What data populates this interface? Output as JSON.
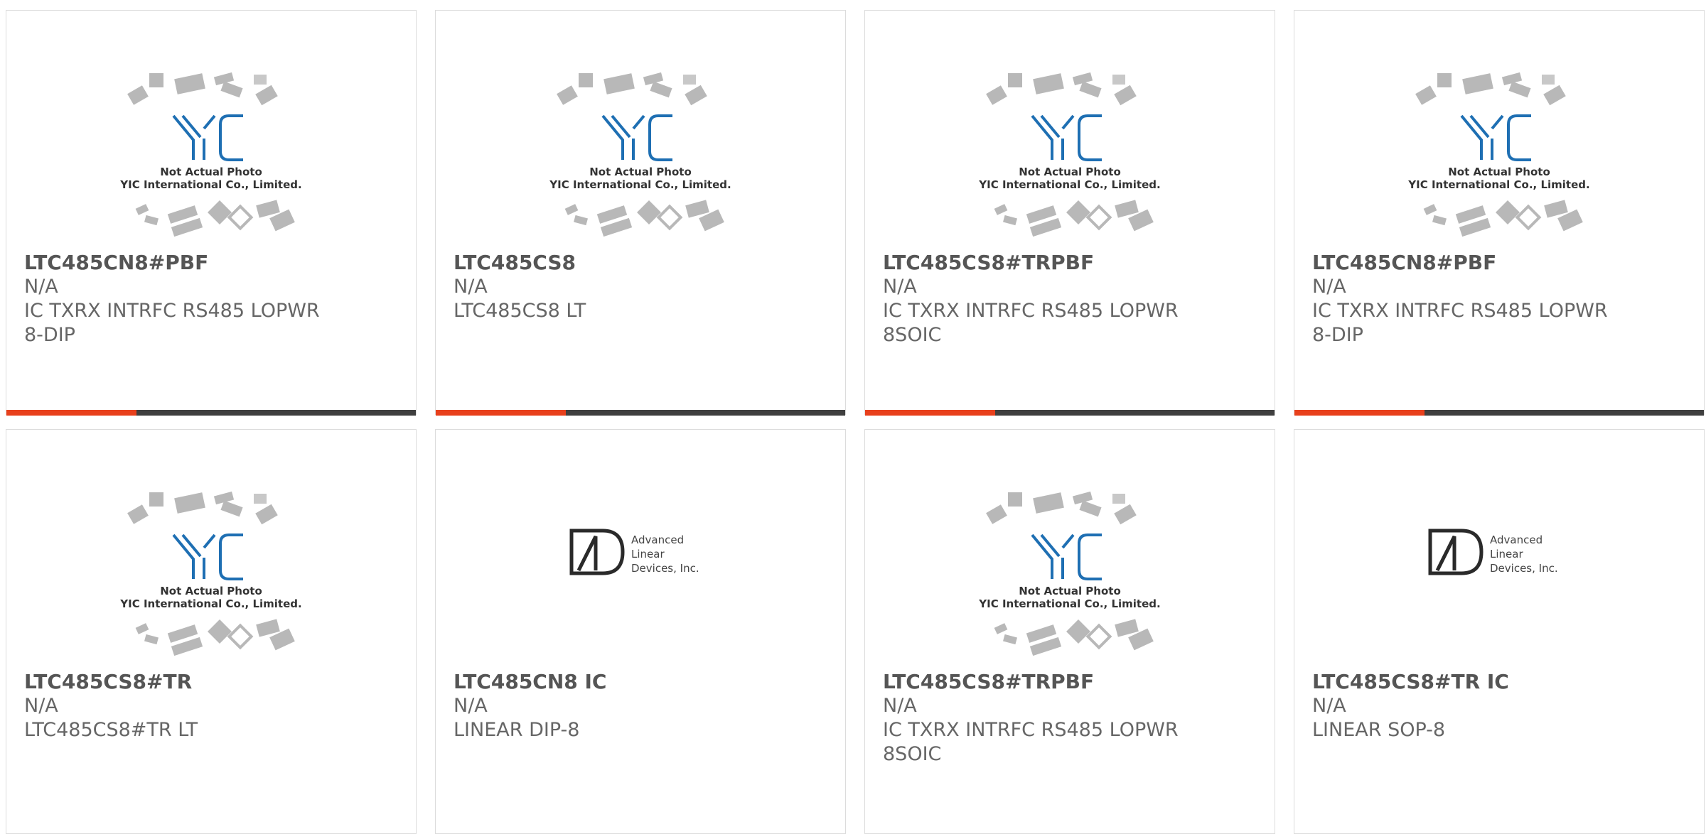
{
  "colors": {
    "accent": "#e8401c",
    "bar": "#3f3f3f",
    "yic_blue": "#1e6fb3"
  },
  "placeholder_text": {
    "line1": "Not Actual Photo",
    "line2": "YIC International Co., Limited."
  },
  "ald_logo": {
    "line1": "Advanced",
    "line2": "Linear",
    "line3": "Devices, Inc."
  },
  "products": [
    {
      "part": "LTC485CN8#PBF",
      "mfr": "N/A",
      "desc1": "IC TXRX INTRFC RS485 LOPWR",
      "desc2": "8-DIP",
      "image": "yic-placeholder"
    },
    {
      "part": "LTC485CS8",
      "mfr": "N/A",
      "desc1": "LTC485CS8 LT",
      "desc2": "",
      "image": "yic-placeholder"
    },
    {
      "part": "LTC485CS8#TRPBF",
      "mfr": "N/A",
      "desc1": "IC TXRX INTRFC RS485 LOPWR",
      "desc2": "8SOIC",
      "image": "yic-placeholder"
    },
    {
      "part": "LTC485CN8#PBF",
      "mfr": "N/A",
      "desc1": "IC TXRX INTRFC RS485 LOPWR",
      "desc2": "8-DIP",
      "image": "yic-placeholder"
    },
    {
      "part": "LTC485CS8#TR",
      "mfr": "N/A",
      "desc1": "LTC485CS8#TR LT",
      "desc2": "",
      "image": "yic-placeholder"
    },
    {
      "part": "LTC485CN8 IC",
      "mfr": "N/A",
      "desc1": "LINEAR DIP-8",
      "desc2": "",
      "image": "ald-logo"
    },
    {
      "part": "LTC485CS8#TRPBF",
      "mfr": "N/A",
      "desc1": "IC TXRX INTRFC RS485 LOPWR",
      "desc2": "8SOIC",
      "image": "yic-placeholder"
    },
    {
      "part": "LTC485CS8#TR IC",
      "mfr": "N/A",
      "desc1": "LINEAR SOP-8",
      "desc2": "",
      "image": "ald-logo"
    }
  ]
}
